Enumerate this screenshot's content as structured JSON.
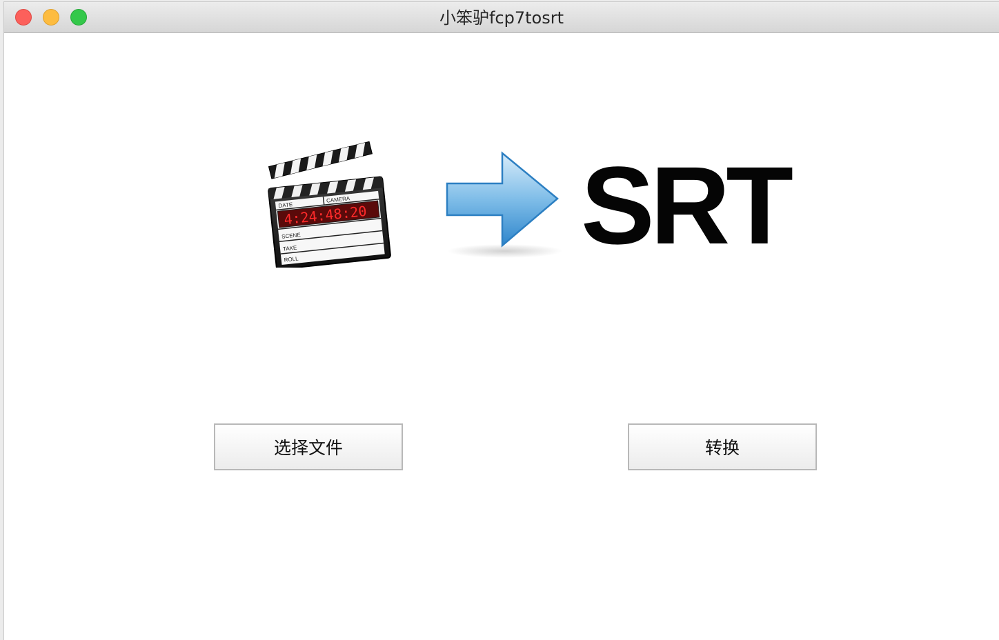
{
  "window": {
    "title": "小笨驴fcp7tosrt"
  },
  "icons": {
    "source": "film-clapperboard-icon",
    "arrow": "right-arrow-icon"
  },
  "clapperboard": {
    "date_label": "DATE",
    "camera_label": "CAMERA",
    "timecode": "4:24:48:20",
    "scene_label": "SCENE",
    "take_label": "TAKE",
    "roll_label": "ROLL"
  },
  "target_label": "SRT",
  "buttons": {
    "choose_file": "选择文件",
    "convert": "转换"
  },
  "colors": {
    "close": "#fc605b",
    "minimize": "#fdbc40",
    "maximize": "#34c84a",
    "arrow_blue": "#4a9bd8",
    "timecode_red": "#e02020"
  }
}
